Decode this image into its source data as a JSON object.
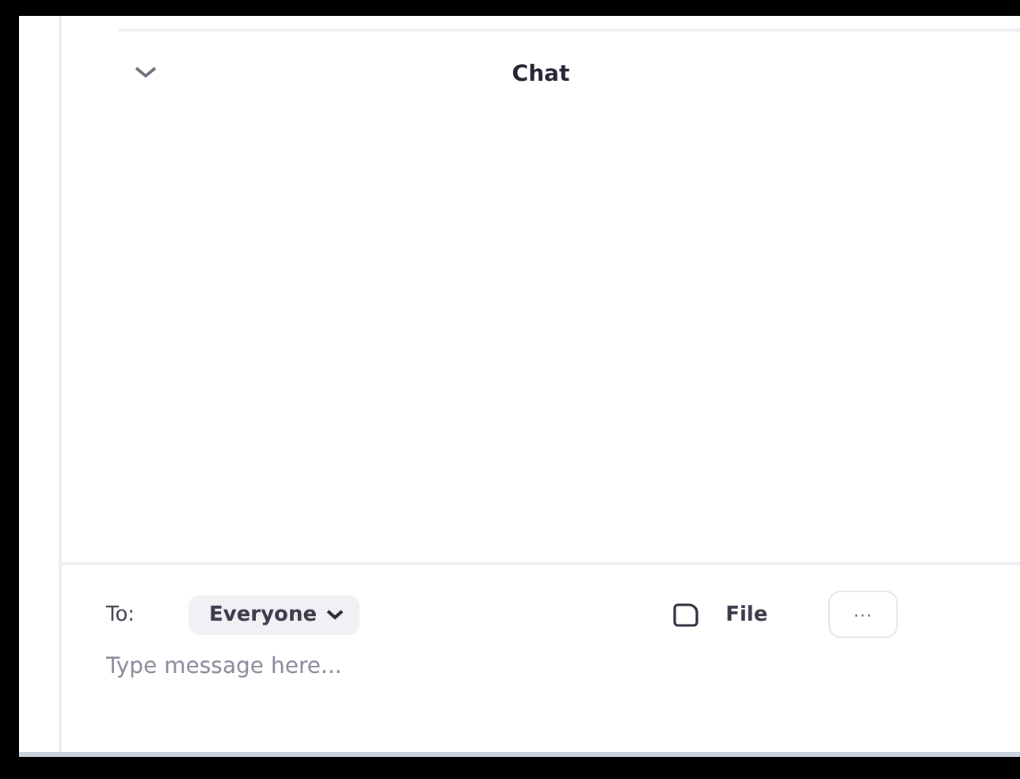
{
  "panel": {
    "title": "Chat",
    "collapse_expanded": true
  },
  "composer": {
    "to_label": "To:",
    "recipient": "Everyone",
    "file_label": "File",
    "more_label": "···",
    "placeholder": "Type message here..."
  }
}
